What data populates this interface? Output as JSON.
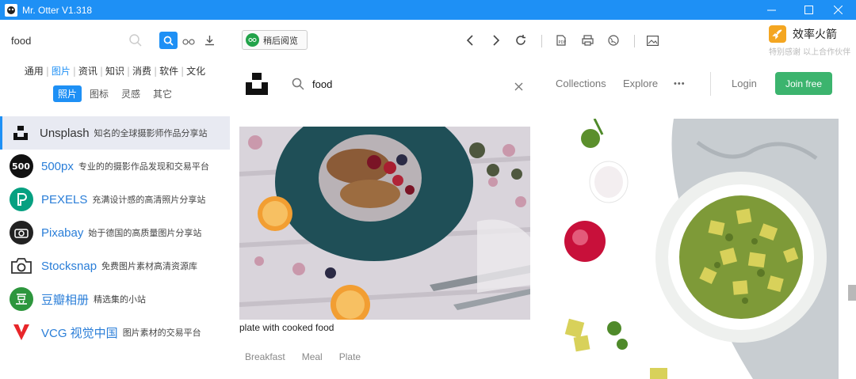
{
  "window": {
    "title": "Mr. Otter V1.318"
  },
  "sidebar": {
    "search_value": "food",
    "categories": [
      "通用",
      "图片",
      "资讯",
      "知识",
      "消费",
      "软件",
      "文化"
    ],
    "active_category": "图片",
    "subcategories": [
      "照片",
      "图标",
      "灵感",
      "其它"
    ],
    "sites": [
      {
        "name": "Unsplash",
        "desc": "知名的全球摄影师作品分享站"
      },
      {
        "name": "500px",
        "desc": "专业的的摄影作品发现和交易平台"
      },
      {
        "name": "PEXELS",
        "desc": "充满设计感的高清照片分享站"
      },
      {
        "name": "Pixabay",
        "desc": "始于德国的高质量图片分享站"
      },
      {
        "name": "Stocksnap",
        "desc": "免费图片素材高清资源库"
      },
      {
        "name": "豆瓣相册",
        "desc": "精选集的小站"
      },
      {
        "name": "VCG 视觉中国",
        "desc": "图片素材的交易平台"
      }
    ]
  },
  "toolbar": {
    "read_later_label": "稍后阅览",
    "promo_title": "效率火箭",
    "promo_subtitle": "特别感谢 以上合作伙伴"
  },
  "webview": {
    "search_value": "food",
    "nav": {
      "collections": "Collections",
      "explore": "Explore",
      "more": "•••",
      "login": "Login",
      "join": "Join free"
    },
    "photo_caption": "plate with cooked food",
    "tags": [
      "Breakfast",
      "Meal",
      "Plate"
    ]
  },
  "colors": {
    "accent": "#1e90f5",
    "join_green": "#3cb46e",
    "link_blue": "#2a7ed8"
  },
  "icons": [
    "app-icon",
    "minimize-icon",
    "maximize-icon",
    "close-icon",
    "search-icon",
    "glasses-icon",
    "download-icon",
    "back-icon",
    "forward-icon",
    "refresh-icon",
    "pdf-icon",
    "print-icon",
    "globe-icon",
    "image-icon",
    "rocket-icon"
  ]
}
